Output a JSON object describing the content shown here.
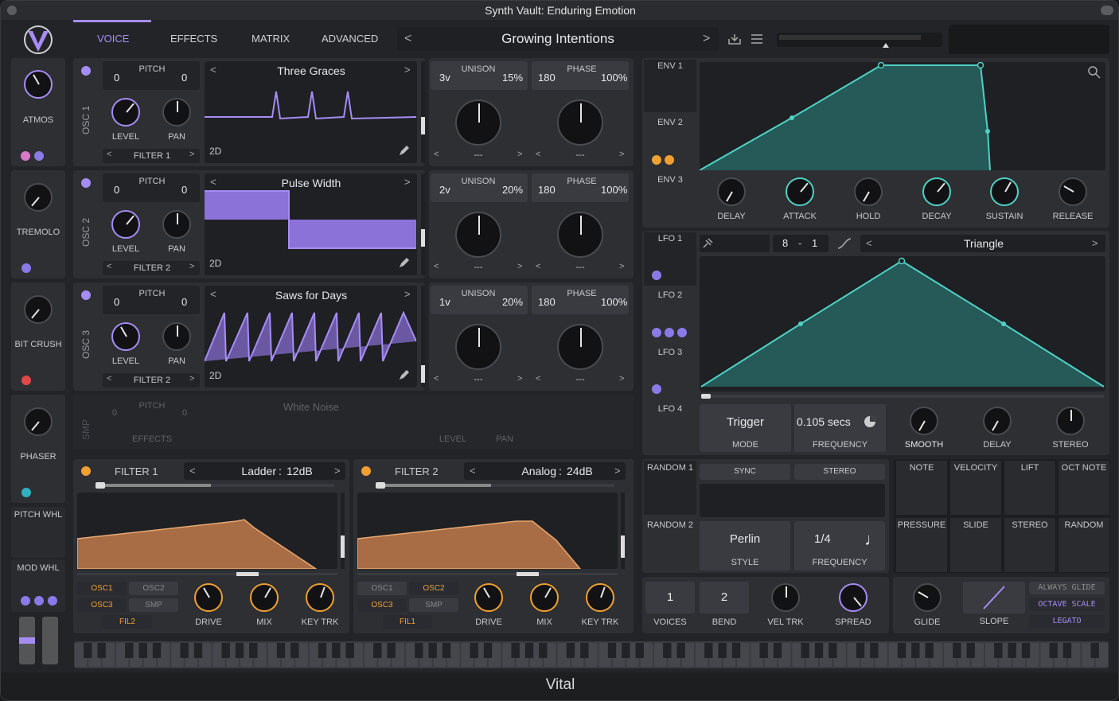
{
  "window": {
    "title": "Synth Vault: Enduring Emotion",
    "footer": "Vital"
  },
  "nav": {
    "tabs": [
      "VOICE",
      "EFFECTS",
      "MATRIX",
      "ADVANCED"
    ],
    "preset": "Growing Intentions"
  },
  "fx_side": [
    {
      "label": "ATMOS"
    },
    {
      "label": "TREMOLO"
    },
    {
      "label": "BIT CRUSH"
    },
    {
      "label": "PHASER"
    },
    {
      "label": "PITCH WHL"
    },
    {
      "label": "MOD WHL"
    }
  ],
  "oscillators": [
    {
      "name": "OSC 1",
      "pitch_label": "PITCH",
      "pitch_l": "0",
      "pitch_r": "0",
      "wave": "Three Graces",
      "level": "LEVEL",
      "pan": "PAN",
      "filter": "FILTER 1",
      "dim": "2D",
      "unison_voices": "3v",
      "unison_label": "UNISON",
      "unison_detune": "15%",
      "phase_val": "180",
      "phase_label": "PHASE",
      "phase_pct": "100%",
      "bottom": "---"
    },
    {
      "name": "OSC 2",
      "pitch_label": "PITCH",
      "pitch_l": "0",
      "pitch_r": "0",
      "wave": "Pulse Width",
      "level": "LEVEL",
      "pan": "PAN",
      "filter": "FILTER 2",
      "dim": "2D",
      "unison_voices": "2v",
      "unison_label": "UNISON",
      "unison_detune": "20%",
      "phase_val": "180",
      "phase_label": "PHASE",
      "phase_pct": "100%",
      "bottom": "---"
    },
    {
      "name": "OSC 3",
      "pitch_label": "PITCH",
      "pitch_l": "0",
      "pitch_r": "0",
      "wave": "Saws for Days",
      "level": "LEVEL",
      "pan": "PAN",
      "filter": "FILTER 2",
      "dim": "2D",
      "unison_voices": "1v",
      "unison_label": "UNISON",
      "unison_detune": "20%",
      "phase_val": "180",
      "phase_label": "PHASE",
      "phase_pct": "100%",
      "bottom": "---"
    }
  ],
  "smp": {
    "name": "SMP",
    "pitch_label": "PITCH",
    "pitch_l": "0",
    "pitch_r": "0",
    "wave": "White Noise",
    "effects": "EFFECTS",
    "level": "LEVEL",
    "pan": "PAN"
  },
  "filters": [
    {
      "name": "FILTER 1",
      "type": "Ladder",
      "slope": "12dB",
      "routes": [
        "OSC1",
        "OSC2",
        "OSC3",
        "SMP",
        "FIL2"
      ],
      "drive": "DRIVE",
      "mix": "MIX",
      "keytrk": "KEY TRK"
    },
    {
      "name": "FILTER 2",
      "type": "Analog",
      "slope": "24dB",
      "routes": [
        "OSC1",
        "OSC2",
        "OSC3",
        "SMP",
        "FIL1"
      ],
      "drive": "DRIVE",
      "mix": "MIX",
      "keytrk": "KEY TRK"
    }
  ],
  "env": {
    "tabs": [
      "ENV 1",
      "ENV 2",
      "ENV 3"
    ],
    "knobs": [
      "DELAY",
      "ATTACK",
      "HOLD",
      "DECAY",
      "SUSTAIN",
      "RELEASE"
    ]
  },
  "lfo": {
    "tabs": [
      "LFO 1",
      "LFO 2",
      "LFO 3",
      "LFO 4"
    ],
    "sync_l": "8",
    "sync_dash": "-",
    "sync_r": "1",
    "shape": "Triangle",
    "mode": "Trigger",
    "mode_label": "MODE",
    "freq": "0.105 secs",
    "freq_label": "FREQUENCY",
    "smooth": "SMOOTH",
    "delay": "DELAY",
    "stereo": "STEREO"
  },
  "random": {
    "tabs": [
      "RANDOM 1",
      "RANDOM 2"
    ],
    "sync": "SYNC",
    "stereo": "STEREO",
    "style": "Perlin",
    "style_label": "STYLE",
    "freq": "1/4",
    "freq_label": "FREQUENCY"
  },
  "mod_sources": [
    "NOTE",
    "VELOCITY",
    "LIFT",
    "OCT NOTE",
    "PRESSURE",
    "SLIDE",
    "STEREO",
    "RANDOM"
  ],
  "voice": {
    "voices": "1",
    "voices_label": "VOICES",
    "bend": "2",
    "bend_label": "BEND",
    "veltrk": "VEL TRK",
    "spread": "SPREAD",
    "glide": "GLIDE",
    "slope": "SLOPE",
    "always_glide": "ALWAYS GLIDE",
    "octave_scale": "OCTAVE SCALE",
    "legato": "LEGATO"
  },
  "colors": {
    "accent": "#a68cf5",
    "orange": "#f0a030",
    "teal": "#4fd1c5"
  }
}
